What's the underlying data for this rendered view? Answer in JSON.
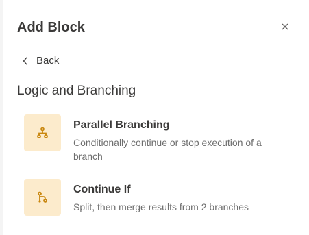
{
  "header": {
    "title": "Add Block",
    "close_icon": "close-icon"
  },
  "nav": {
    "back_label": "Back",
    "back_icon": "chevron-left-icon"
  },
  "section": {
    "title": "Logic and Branching"
  },
  "blocks": [
    {
      "name": "Parallel Branching",
      "description": "Conditionally continue or stop execution of a branch",
      "icon": "parallel-branching-icon"
    },
    {
      "name": "Continue If",
      "description": "Split, then merge results from 2 branches",
      "icon": "continue-if-icon"
    }
  ],
  "colors": {
    "icon_tile_bg": "#fcebcc",
    "icon_accent": "#c9870f",
    "text_primary": "#3b3a39",
    "text_secondary": "#6e6e6e"
  }
}
